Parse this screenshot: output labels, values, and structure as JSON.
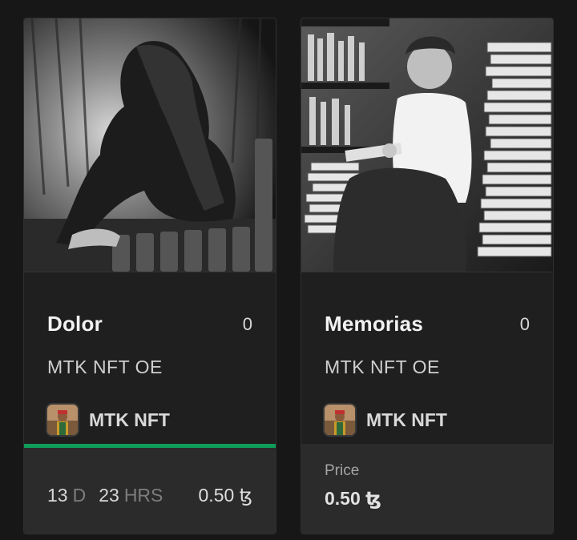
{
  "cards": [
    {
      "title": "Dolor",
      "count": "0",
      "collection": "MTK NFT OE",
      "creator": "MTK NFT",
      "timer": {
        "days": "13",
        "days_unit": "D",
        "hours": "23",
        "hours_unit": "HRS"
      },
      "price": "0.50 ꜩ",
      "auction_progress": 1.0,
      "progress_color": "#0f9d5a"
    },
    {
      "title": "Memorias",
      "count": "0",
      "collection": "MTK NFT OE",
      "creator": "MTK NFT",
      "price_label": "Price",
      "price": "0.50 ꜩ"
    }
  ]
}
